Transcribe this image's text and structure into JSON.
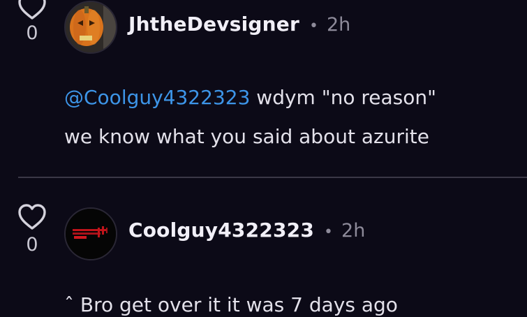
{
  "comments": [
    {
      "likes": "0",
      "username": "JhtheDevsigner",
      "separator": "•",
      "time": "2h",
      "mention": "@Coolguy4322323",
      "text_line1": " wdym \"no reason\"",
      "text_line2": "we know what you said about azurite",
      "avatar_icon": "pumpkin-avatar"
    },
    {
      "likes": "0",
      "username": "Coolguy4322323",
      "separator": "•",
      "time": "2h",
      "text_line1": "ˆ Bro get over it it was 7 days ago",
      "avatar_icon": "red-text-avatar"
    }
  ],
  "colors": {
    "background": "#0c0a17",
    "mention": "#3d95e8",
    "muted": "#8d8a99",
    "divider": "#3a3746"
  }
}
